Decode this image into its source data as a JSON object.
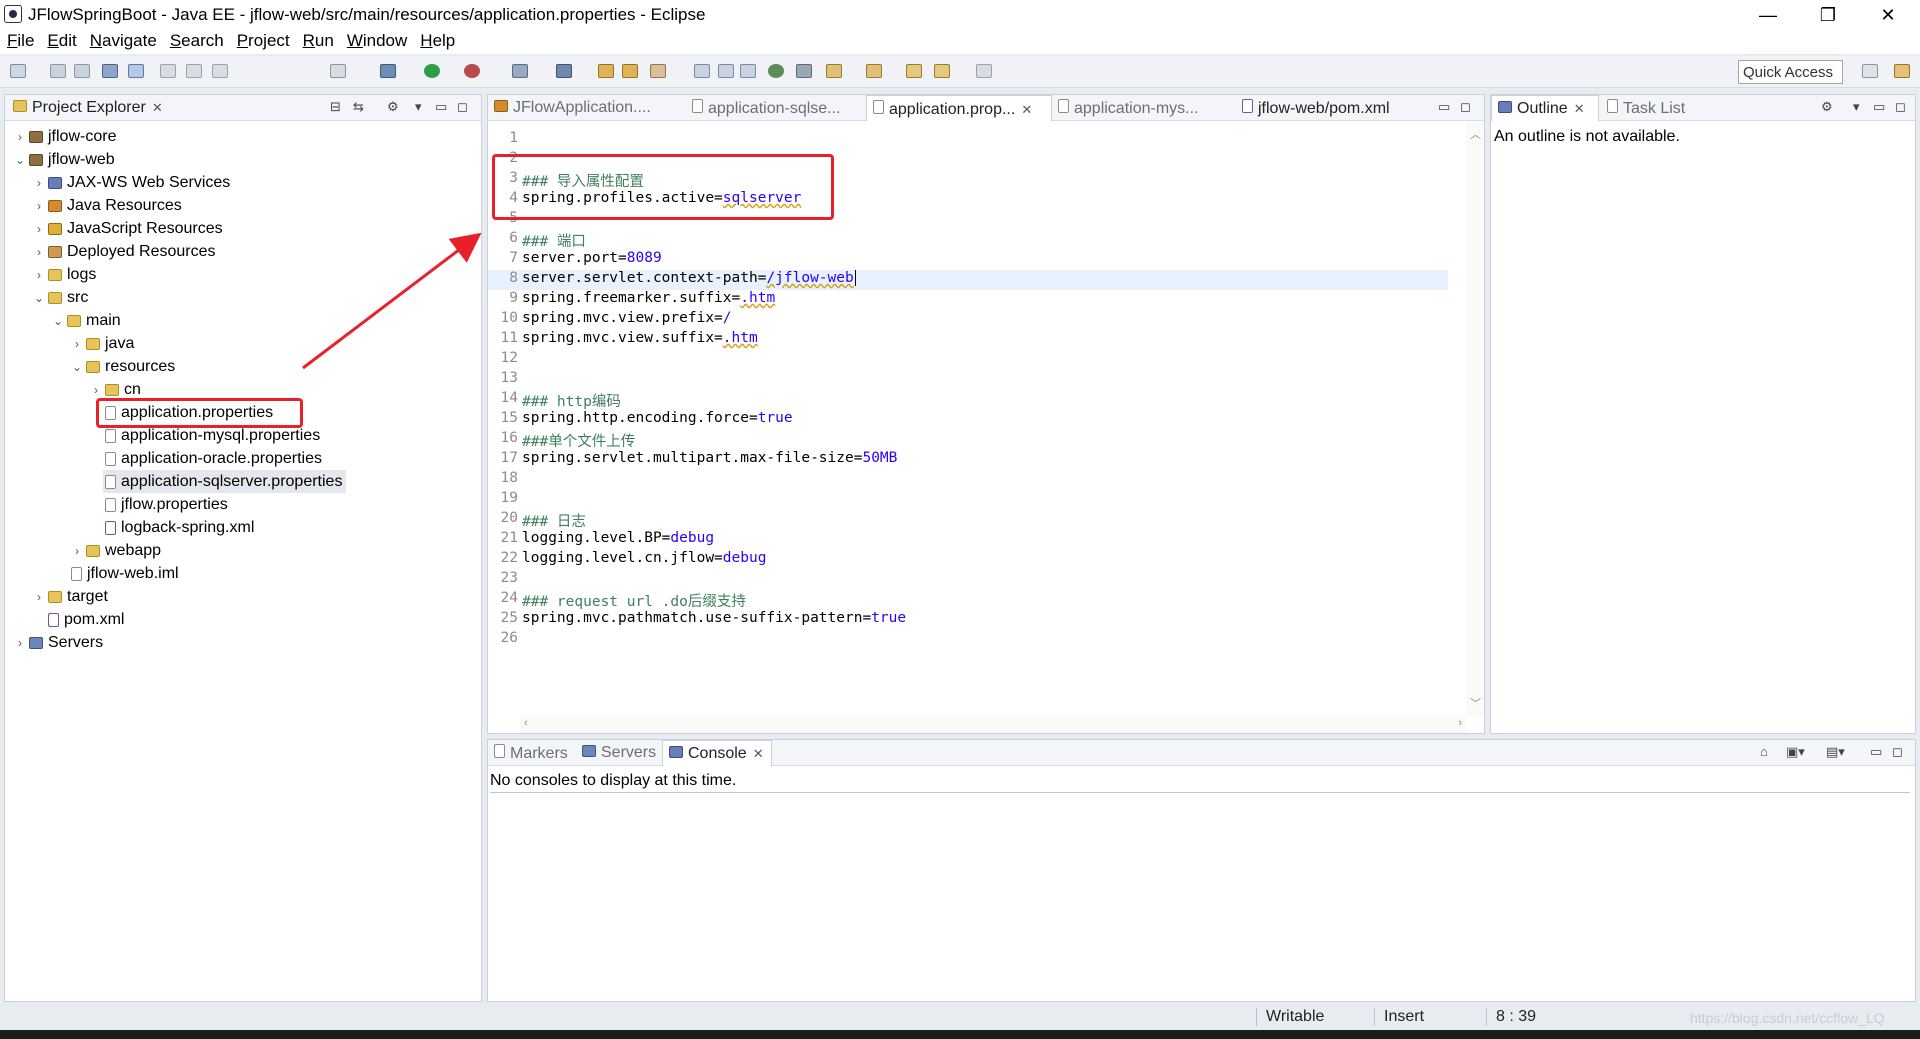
{
  "window": {
    "title": "JFlowSpringBoot - Java EE - jflow-web/src/main/resources/application.properties - Eclipse",
    "minimize": "—",
    "maximize": "❐",
    "close": "✕"
  },
  "menu": [
    "File",
    "Edit",
    "Navigate",
    "Search",
    "Project",
    "Run",
    "Window",
    "Help"
  ],
  "toolbar": {
    "quick_access": "Quick Access"
  },
  "project_explorer": {
    "title": "Project Explorer",
    "close": "✕",
    "tree": [
      {
        "label": "jflow-core",
        "icon": "project-icon"
      },
      {
        "label": "jflow-web",
        "icon": "project-icon"
      },
      {
        "label": "JAX-WS Web Services",
        "icon": "webservice-icon"
      },
      {
        "label": "Java Resources",
        "icon": "java-resources-icon"
      },
      {
        "label": "JavaScript Resources",
        "icon": "javascript-icon"
      },
      {
        "label": "Deployed Resources",
        "icon": "deployed-icon"
      },
      {
        "label": "logs",
        "icon": "folder-icon"
      },
      {
        "label": "src",
        "icon": "folder-icon"
      },
      {
        "label": "main",
        "icon": "folder-icon"
      },
      {
        "label": "java",
        "icon": "folder-icon"
      },
      {
        "label": "resources",
        "icon": "folder-icon"
      },
      {
        "label": "cn",
        "icon": "folder-icon"
      },
      {
        "label": "application.properties",
        "icon": "file-icon"
      },
      {
        "label": "application-mysql.properties",
        "icon": "file-icon"
      },
      {
        "label": "application-oracle.properties",
        "icon": "file-icon"
      },
      {
        "label": "application-sqlserver.properties",
        "icon": "file-icon"
      },
      {
        "label": "jflow.properties",
        "icon": "file-icon"
      },
      {
        "label": "logback-spring.xml",
        "icon": "xml-icon"
      },
      {
        "label": "webapp",
        "icon": "folder-icon"
      },
      {
        "label": "jflow-web.iml",
        "icon": "file-icon"
      },
      {
        "label": "target",
        "icon": "folder-icon"
      },
      {
        "label": "pom.xml",
        "icon": "file-icon"
      },
      {
        "label": "Servers",
        "icon": "server-icon"
      }
    ]
  },
  "editor": {
    "tabs": [
      {
        "label": "JFlowApplication...."
      },
      {
        "label": "application-sqlse..."
      },
      {
        "label": "application.prop..."
      },
      {
        "label": "application-mys..."
      },
      {
        "label": "jflow-web/pom.xml"
      }
    ],
    "tab_close": "✕",
    "line_numbers": [
      "1",
      "2",
      "3",
      "4",
      "5",
      "6",
      "7",
      "8",
      "9",
      "10",
      "11",
      "12",
      "13",
      "14",
      "15",
      "16",
      "17",
      "18",
      "19",
      "20",
      "21",
      "22",
      "23",
      "24",
      "25",
      "26"
    ],
    "lines": {
      "l3": "### 导入属性配置",
      "l4_key": "spring.profiles.active=",
      "l4_val": "sqlserver",
      "l6": "### 端口",
      "l7_key": "server.port=",
      "l7_val": "8089",
      "l8_key": "server.servlet.context-path=",
      "l8_val": "/jflow-web",
      "l9_key": "spring.freemarker.suffix=",
      "l9_val": ".htm",
      "l10_key": "spring.mvc.view.prefix=",
      "l10_val": "/",
      "l11_key": "spring.mvc.view.suffix=",
      "l11_val": ".htm",
      "l14": "### http编码",
      "l15_key": "spring.http.encoding.force=",
      "l15_val": "true",
      "l16": "###单个文件上传",
      "l17_key": "spring.servlet.multipart.max-file-size=",
      "l17_val": "50MB",
      "l20": "### 日志",
      "l21_key": "logging.level.BP=",
      "l21_val": "debug",
      "l22_key": "logging.level.cn.jflow=",
      "l22_val": "debug",
      "l24": "### request url .do后缀支持",
      "l25_key": "spring.mvc.pathmatch.use-suffix-pattern=",
      "l25_val": "true"
    }
  },
  "outline": {
    "tab_outline": "Outline",
    "tab_tasklist": "Task List",
    "message": "An outline is not available."
  },
  "console": {
    "tab_markers": "Markers",
    "tab_servers": "Servers",
    "tab_console": "Console",
    "message": "No consoles to display at this time."
  },
  "status": {
    "writable": "Writable",
    "insert": "Insert",
    "position": "8 : 39"
  },
  "watermark": "https://blog.csdn.net/ccflow_LQ",
  "colors": {
    "annotation": "#e8202a",
    "keyword_value": "#2a00ff",
    "comment": "#3f7f5f"
  }
}
